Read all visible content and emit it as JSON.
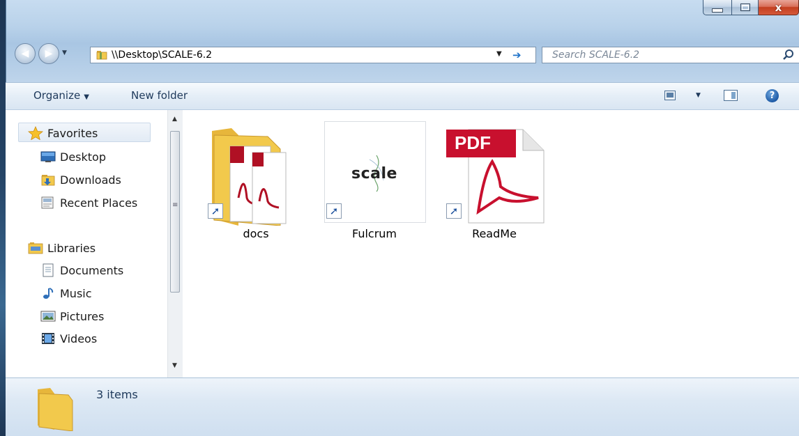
{
  "window": {
    "address_path": "\\\\Desktop\\SCALE-6.2",
    "search_placeholder": "Search SCALE-6.2",
    "close_glyph": "x"
  },
  "toolbar": {
    "organize_label": "Organize",
    "new_folder_label": "New folder",
    "help_glyph": "?"
  },
  "sidebar": {
    "favorites": {
      "label": "Favorites",
      "items": [
        {
          "label": "Desktop",
          "icon": "desktop-icon"
        },
        {
          "label": "Downloads",
          "icon": "downloads-folder-icon"
        },
        {
          "label": "Recent Places",
          "icon": "recent-places-icon"
        }
      ]
    },
    "libraries": {
      "label": "Libraries",
      "items": [
        {
          "label": "Documents",
          "icon": "documents-icon"
        },
        {
          "label": "Music",
          "icon": "music-icon"
        },
        {
          "label": "Pictures",
          "icon": "pictures-icon"
        },
        {
          "label": "Videos",
          "icon": "videos-icon"
        }
      ]
    }
  },
  "files": [
    {
      "label": "docs",
      "icon": "folder-shortcut-icon"
    },
    {
      "label": "Fulcrum",
      "icon": "scale-app-shortcut-icon",
      "logo_text": "scale"
    },
    {
      "label": "ReadMe",
      "icon": "pdf-shortcut-icon",
      "badge_text": "PDF"
    }
  ],
  "status": {
    "item_count": "3 items"
  },
  "colors": {
    "accent": "#1d72c9",
    "pdf_red": "#c8102e",
    "folder_yellow": "#f2c94c"
  }
}
